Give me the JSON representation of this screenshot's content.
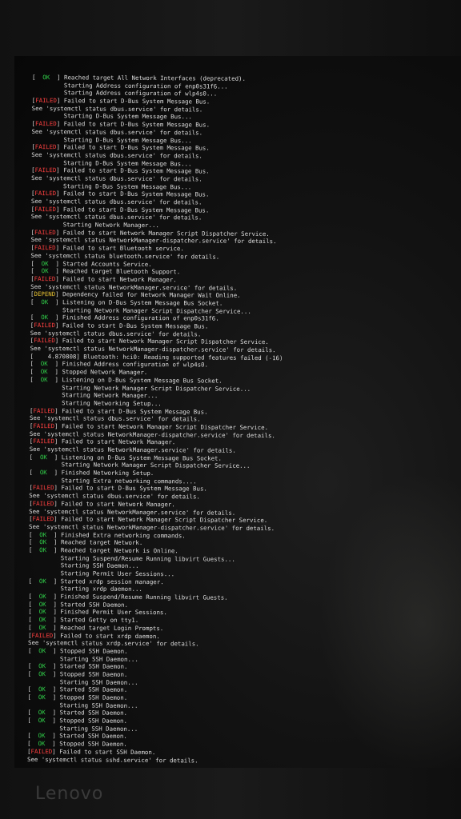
{
  "console": {
    "lines": [
      {
        "status": "  OK  ",
        "type": "ok",
        "text": "Reached target All Network Interfaces (deprecated)."
      },
      {
        "status": "",
        "type": "",
        "text": "         Starting Address configuration of enp0s31f6..."
      },
      {
        "status": "",
        "type": "",
        "text": "         Starting Address configuration of wlp4s0..."
      },
      {
        "status": "FAILED",
        "type": "failed",
        "text": "Failed to start D-Bus System Message Bus."
      },
      {
        "status": "",
        "type": "",
        "text": "See 'systemctl status dbus.service' for details."
      },
      {
        "status": "",
        "type": "",
        "text": "         Starting D-Bus System Message Bus..."
      },
      {
        "status": "FAILED",
        "type": "failed",
        "text": "Failed to start D-Bus System Message Bus."
      },
      {
        "status": "",
        "type": "",
        "text": "See 'systemctl status dbus.service' for details."
      },
      {
        "status": "",
        "type": "",
        "text": "         Starting D-Bus System Message Bus..."
      },
      {
        "status": "FAILED",
        "type": "failed",
        "text": "Failed to start D-Bus System Message Bus."
      },
      {
        "status": "",
        "type": "",
        "text": "See 'systemctl status dbus.service' for details."
      },
      {
        "status": "",
        "type": "",
        "text": "         Starting D-Bus System Message Bus..."
      },
      {
        "status": "FAILED",
        "type": "failed",
        "text": "Failed to start D-Bus System Message Bus."
      },
      {
        "status": "",
        "type": "",
        "text": "See 'systemctl status dbus.service' for details."
      },
      {
        "status": "",
        "type": "",
        "text": "         Starting D-Bus System Message Bus..."
      },
      {
        "status": "FAILED",
        "type": "failed",
        "text": "Failed to start D-Bus System Message Bus."
      },
      {
        "status": "",
        "type": "",
        "text": "See 'systemctl status dbus.service' for details."
      },
      {
        "status": "FAILED",
        "type": "failed",
        "text": "Failed to start D-Bus System Message Bus."
      },
      {
        "status": "",
        "type": "",
        "text": "See 'systemctl status dbus.service' for details."
      },
      {
        "status": "",
        "type": "",
        "text": "         Starting Network Manager..."
      },
      {
        "status": "FAILED",
        "type": "failed",
        "text": "Failed to start Network Manager Script Dispatcher Service."
      },
      {
        "status": "",
        "type": "",
        "text": "See 'systemctl status NetworkManager-dispatcher.service' for details."
      },
      {
        "status": "FAILED",
        "type": "failed",
        "text": "Failed to start Bluetooth service."
      },
      {
        "status": "",
        "type": "",
        "text": "See 'systemctl status bluetooth.service' for details."
      },
      {
        "status": "  OK  ",
        "type": "ok",
        "text": "Started Accounts Service."
      },
      {
        "status": "  OK  ",
        "type": "ok",
        "text": "Reached target Bluetooth Support."
      },
      {
        "status": "FAILED",
        "type": "failed",
        "text": "Failed to start Network Manager."
      },
      {
        "status": "",
        "type": "",
        "text": "See 'systemctl status NetworkManager.service' for details."
      },
      {
        "status": "DEPEND",
        "type": "depend",
        "text": "Dependency failed for Network Manager Wait Online."
      },
      {
        "status": "  OK  ",
        "type": "ok",
        "text": "Listening on D-Bus System Message Bus Socket."
      },
      {
        "status": "",
        "type": "",
        "text": "         Starting Network Manager Script Dispatcher Service..."
      },
      {
        "status": "  OK  ",
        "type": "ok",
        "text": "Finished Address configuration of enp0s31f6."
      },
      {
        "status": "FAILED",
        "type": "failed",
        "text": "Failed to start D-Bus System Message Bus."
      },
      {
        "status": "",
        "type": "",
        "text": "See 'systemctl status dbus.service' for details."
      },
      {
        "status": "FAILED",
        "type": "failed",
        "text": "Failed to start Network Manager Script Dispatcher Service."
      },
      {
        "status": "",
        "type": "",
        "text": "See 'systemctl status NetworkManager-dispatcher.service' for details."
      },
      {
        "status": "",
        "type": "",
        "text": "[    4.870808] Bluetooth: hci0: Reading supported features failed (-16)"
      },
      {
        "status": "  OK  ",
        "type": "ok",
        "text": "Finished Address configuration of wlp4s0."
      },
      {
        "status": "  OK  ",
        "type": "ok",
        "text": "Stopped Network Manager."
      },
      {
        "status": "  OK  ",
        "type": "ok",
        "text": "Listening on D-Bus System Message Bus Socket."
      },
      {
        "status": "",
        "type": "",
        "text": "         Starting Network Manager Script Dispatcher Service..."
      },
      {
        "status": "",
        "type": "",
        "text": "         Starting Network Manager..."
      },
      {
        "status": "",
        "type": "",
        "text": "         Starting Networking Setup..."
      },
      {
        "status": "FAILED",
        "type": "failed",
        "text": "Failed to start D-Bus System Message Bus."
      },
      {
        "status": "",
        "type": "",
        "text": "See 'systemctl status dbus.service' for details."
      },
      {
        "status": "FAILED",
        "type": "failed",
        "text": "Failed to start Network Manager Script Dispatcher Service."
      },
      {
        "status": "",
        "type": "",
        "text": "See 'systemctl status NetworkManager-dispatcher.service' for details."
      },
      {
        "status": "FAILED",
        "type": "failed",
        "text": "Failed to start Network Manager."
      },
      {
        "status": "",
        "type": "",
        "text": "See 'systemctl status NetworkManager.service' for details."
      },
      {
        "status": "  OK  ",
        "type": "ok",
        "text": "Listening on D-Bus System Message Bus Socket."
      },
      {
        "status": "",
        "type": "",
        "text": "         Starting Network Manager Script Dispatcher Service..."
      },
      {
        "status": "  OK  ",
        "type": "ok",
        "text": "Finished Networking Setup."
      },
      {
        "status": "",
        "type": "",
        "text": "         Starting Extra networking commands...."
      },
      {
        "status": "FAILED",
        "type": "failed",
        "text": "Failed to start D-Bus System Message Bus."
      },
      {
        "status": "",
        "type": "",
        "text": "See 'systemctl status dbus.service' for details."
      },
      {
        "status": "FAILED",
        "type": "failed",
        "text": "Failed to start Network Manager."
      },
      {
        "status": "",
        "type": "",
        "text": "See 'systemctl status NetworkManager.service' for details."
      },
      {
        "status": "FAILED",
        "type": "failed",
        "text": "Failed to start Network Manager Script Dispatcher Service."
      },
      {
        "status": "",
        "type": "",
        "text": "See 'systemctl status NetworkManager-dispatcher.service' for details."
      },
      {
        "status": "  OK  ",
        "type": "ok",
        "text": "Finished Extra networking commands."
      },
      {
        "status": "  OK  ",
        "type": "ok",
        "text": "Reached target Network."
      },
      {
        "status": "  OK  ",
        "type": "ok",
        "text": "Reached target Network is Online."
      },
      {
        "status": "",
        "type": "",
        "text": "         Starting Suspend/Resume Running libvirt Guests..."
      },
      {
        "status": "",
        "type": "",
        "text": "         Starting SSH Daemon..."
      },
      {
        "status": "",
        "type": "",
        "text": "         Starting Permit User Sessions..."
      },
      {
        "status": "  OK  ",
        "type": "ok",
        "text": "Started xrdp session manager."
      },
      {
        "status": "",
        "type": "",
        "text": "         Starting xrdp daemon..."
      },
      {
        "status": "  OK  ",
        "type": "ok",
        "text": "Finished Suspend/Resume Running libvirt Guests."
      },
      {
        "status": "  OK  ",
        "type": "ok",
        "text": "Started SSH Daemon."
      },
      {
        "status": "  OK  ",
        "type": "ok",
        "text": "Finished Permit User Sessions."
      },
      {
        "status": "  OK  ",
        "type": "ok",
        "text": "Started Getty on tty1."
      },
      {
        "status": "  OK  ",
        "type": "ok",
        "text": "Reached target Login Prompts."
      },
      {
        "status": "FAILED",
        "type": "failed",
        "text": "Failed to start xrdp daemon."
      },
      {
        "status": "",
        "type": "",
        "text": "See 'systemctl status xrdp.service' for details."
      },
      {
        "status": "  OK  ",
        "type": "ok",
        "text": "Stopped SSH Daemon."
      },
      {
        "status": "",
        "type": "",
        "text": "         Starting SSH Daemon..."
      },
      {
        "status": "  OK  ",
        "type": "ok",
        "text": "Started SSH Daemon."
      },
      {
        "status": "  OK  ",
        "type": "ok",
        "text": "Stopped SSH Daemon."
      },
      {
        "status": "",
        "type": "",
        "text": "         Starting SSH Daemon..."
      },
      {
        "status": "  OK  ",
        "type": "ok",
        "text": "Started SSH Daemon."
      },
      {
        "status": "  OK  ",
        "type": "ok",
        "text": "Stopped SSH Daemon."
      },
      {
        "status": "",
        "type": "",
        "text": "         Starting SSH Daemon..."
      },
      {
        "status": "  OK  ",
        "type": "ok",
        "text": "Started SSH Daemon."
      },
      {
        "status": "  OK  ",
        "type": "ok",
        "text": "Stopped SSH Daemon."
      },
      {
        "status": "",
        "type": "",
        "text": "         Starting SSH Daemon..."
      },
      {
        "status": "  OK  ",
        "type": "ok",
        "text": "Started SSH Daemon."
      },
      {
        "status": "  OK  ",
        "type": "ok",
        "text": "Stopped SSH Daemon."
      },
      {
        "status": "FAILED",
        "type": "failed",
        "text": "Failed to start SSH Daemon."
      },
      {
        "status": "",
        "type": "",
        "text": "See 'systemctl status sshd.service' for details."
      }
    ],
    "cursor": "_"
  },
  "bezel": {
    "logo": "Lenovo"
  },
  "colors": {
    "ok": "#31d14a",
    "failed": "#ff4040",
    "depend": "#e8c233",
    "text": "#dcdcdc",
    "background": "#0a0a0a"
  }
}
